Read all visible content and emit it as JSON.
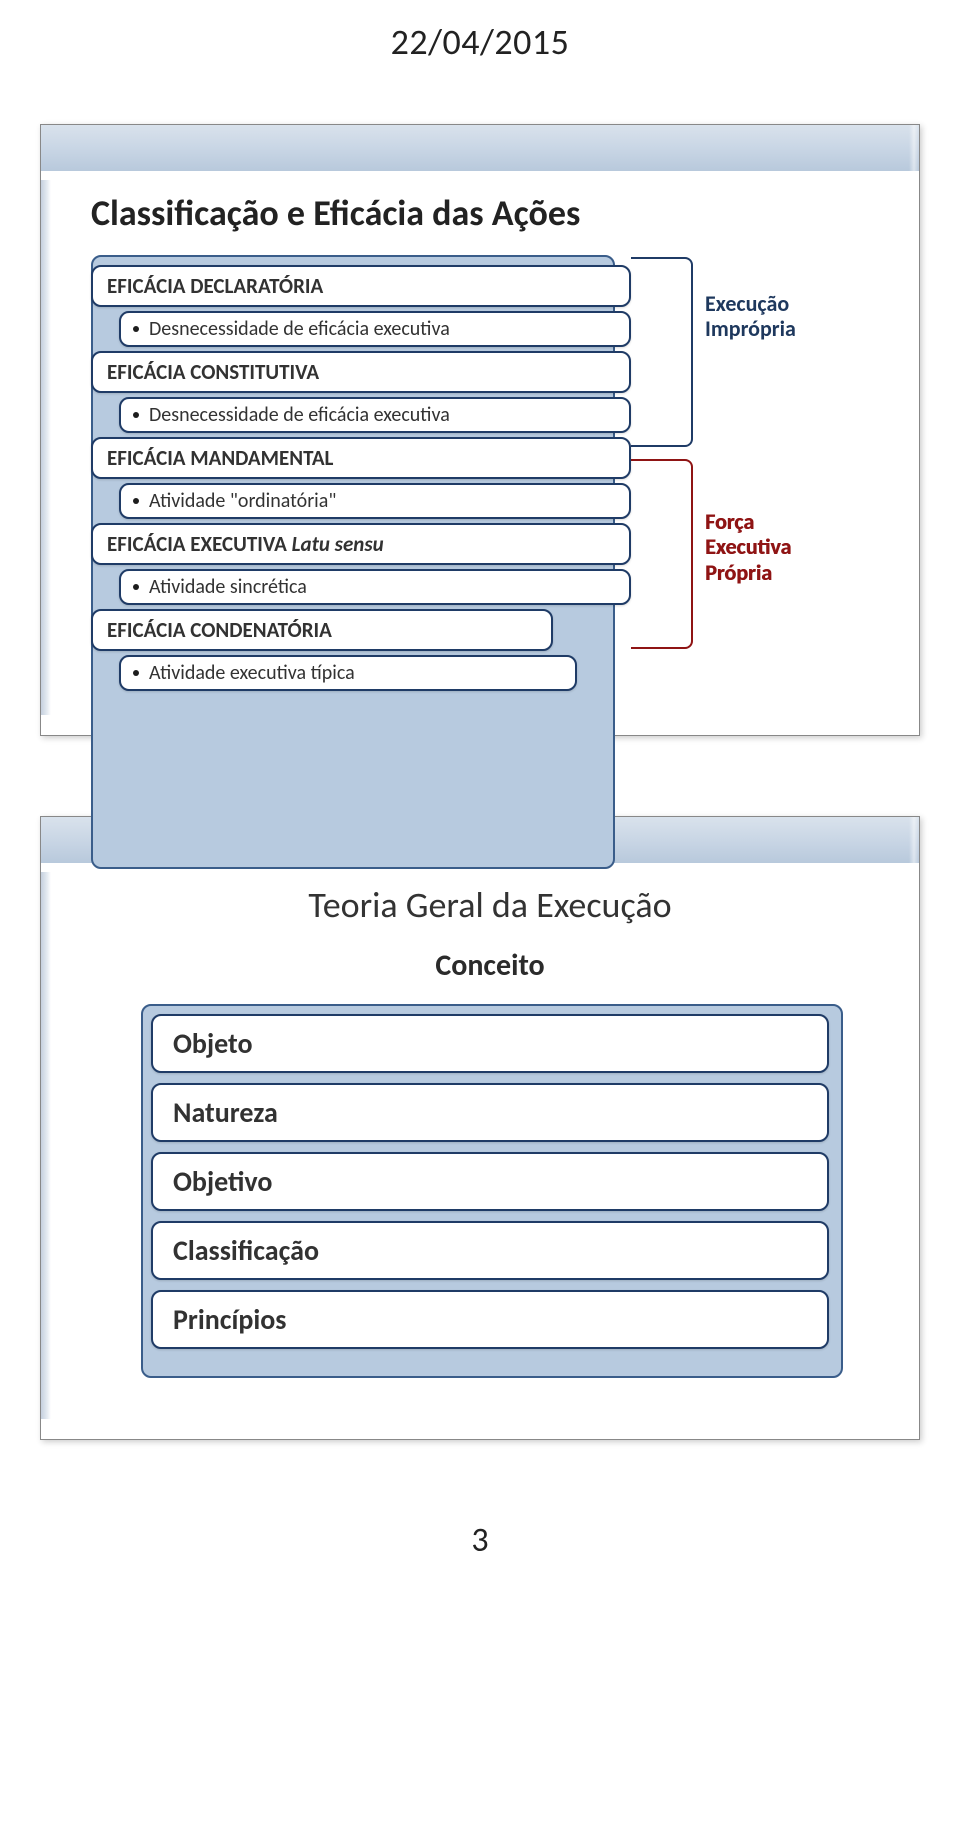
{
  "date": "22/04/2015",
  "slide1": {
    "title": "Classificação e Eficácia das Ações",
    "items": [
      {
        "label": "EFICÁCIA DECLARATÓRIA",
        "type": "head"
      },
      {
        "label": "Desnecessidade de eficácia executiva",
        "type": "sub"
      },
      {
        "label": "EFICÁCIA CONSTITUTIVA",
        "type": "head"
      },
      {
        "label": "Desnecessidade de eficácia executiva",
        "type": "sub"
      },
      {
        "label": "EFICÁCIA MANDAMENTAL",
        "type": "head"
      },
      {
        "label": "Atividade \"ordinatória\"",
        "type": "sub"
      },
      {
        "label": "EFICÁCIA EXECUTIVA Latu sensu",
        "type": "head"
      },
      {
        "label": "Atividade sincrética",
        "type": "sub"
      },
      {
        "label": "EFICÁCIA CONDENATÓRIA",
        "type": "head-short"
      },
      {
        "label": "Atividade executiva típica",
        "type": "sub-short"
      }
    ],
    "right": {
      "exec_impropria_l1": "Execução",
      "exec_impropria_l2": "Imprópria",
      "forca_l1": "Força",
      "forca_l2": "Executiva",
      "forca_l3": "Própria"
    }
  },
  "slide2": {
    "title": "Teoria Geral da Execução",
    "subtitle": "Conceito",
    "items": [
      "Objeto",
      "Natureza",
      "Objetivo",
      "Classificação",
      "Princípios"
    ]
  },
  "page_number": "3"
}
